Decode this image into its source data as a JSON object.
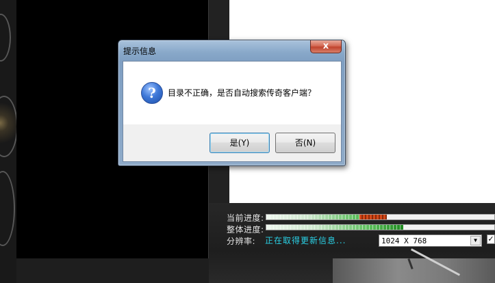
{
  "dialog": {
    "title": "提示信息",
    "close_glyph": "x",
    "message": "目录不正确，是否自动搜索传奇客户端？",
    "icon": "question-icon",
    "yes_label": "是(Y)",
    "no_label": "否(N)"
  },
  "launcher": {
    "current_progress_label": "当前进度:",
    "overall_progress_label": "整体进度:",
    "resolution_label": "分辨率:",
    "status_text": "正在取得更新信息...",
    "resolution_value": "1024 X 768",
    "dropdown_glyph": "▼",
    "fullscreen_checked": "✓",
    "current_progress": 0.53,
    "overall_progress": 0.6,
    "colors": {
      "status": "#2ad1e6",
      "progress_fill": "#1f8a1f",
      "progress_tip": "#d64a1a"
    }
  }
}
